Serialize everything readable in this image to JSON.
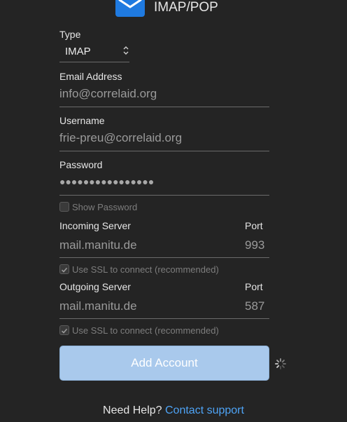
{
  "header": {
    "title": "IMAP/POP",
    "icon": "envelope-icon"
  },
  "form": {
    "type_label": "Type",
    "type_value": "IMAP",
    "email_label": "Email Address",
    "email_value": "info@correlaid.org",
    "username_label": "Username",
    "username_value": "frie-preu@correlaid.org",
    "password_label": "Password",
    "password_value": "●●●●●●●●●●●●●●●●",
    "show_password_label": "Show Password",
    "show_password_checked": false,
    "incoming_label": "Incoming Server",
    "incoming_value": "mail.manitu.de",
    "incoming_port_label": "Port",
    "incoming_port_value": "993",
    "incoming_ssl_label": "Use SSL to connect (recommended)",
    "incoming_ssl_checked": true,
    "outgoing_label": "Outgoing Server",
    "outgoing_value": "mail.manitu.de",
    "outgoing_port_label": "Port",
    "outgoing_port_value": "587",
    "outgoing_ssl_label": "Use SSL to connect (recommended)",
    "outgoing_ssl_checked": true
  },
  "actions": {
    "add_account_label": "Add Account"
  },
  "help": {
    "prefix": "Need Help?",
    "link_label": "Contact support"
  },
  "colors": {
    "accent": "#1f7ae0",
    "button": "#a9c9ec",
    "link": "#4ea3f5",
    "background": "#242424"
  }
}
